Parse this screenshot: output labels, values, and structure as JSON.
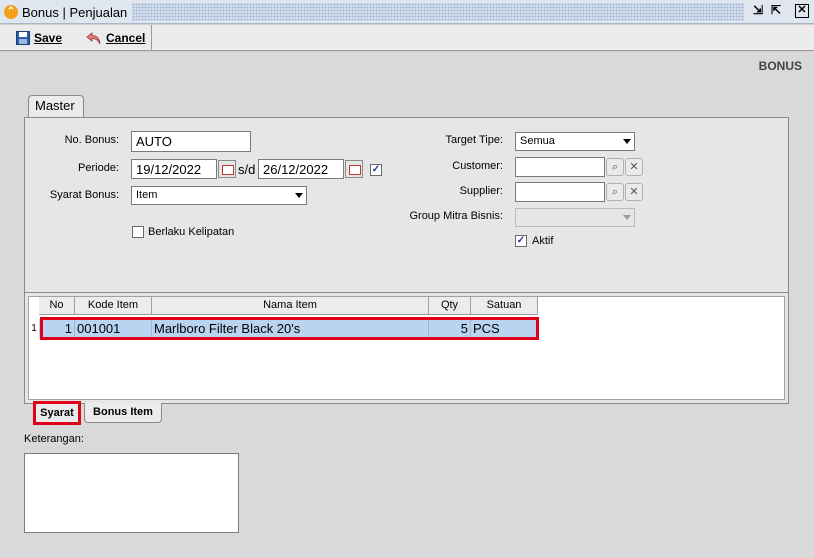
{
  "window": {
    "title": "Bonus | Penjualan",
    "restore_glyph": "⇲",
    "max_glyph": "⇱",
    "close_glyph": "✕"
  },
  "toolbar": {
    "save_label": "Save",
    "cancel_label": "Cancel"
  },
  "header": {
    "label": "BONUS"
  },
  "tabs": {
    "master": "Master"
  },
  "form": {
    "no_bonus_label": "No. Bonus:",
    "no_bonus_value": "AUTO",
    "periode_label": "Periode:",
    "periode_start": "19/12/2022",
    "periode_sep": "s/d",
    "periode_end": "26/12/2022",
    "periode_checked": true,
    "syarat_bonus_label": "Syarat Bonus:",
    "syarat_bonus_value": "Item",
    "berlaku_kelipatan_label": "Berlaku Kelipatan",
    "berlaku_kelipatan_checked": false,
    "target_tipe_label": "Target Tipe:",
    "target_tipe_value": "Semua",
    "customer_label": "Customer:",
    "customer_value": "",
    "supplier_label": "Supplier:",
    "supplier_value": "",
    "group_mitra_label": "Group Mitra Bisnis:",
    "group_mitra_value": "",
    "aktif_label": "Aktif",
    "aktif_checked": true
  },
  "grid": {
    "columns": [
      "No",
      "Kode Item",
      "Nama Item",
      "Qty",
      "Satuan"
    ],
    "rows": [
      {
        "indicator": "1",
        "no": "1",
        "kode": "001001",
        "nama": "Marlboro Filter Black 20's",
        "qty": "5",
        "satuan": "PCS"
      }
    ]
  },
  "bottom_tabs": {
    "syarat": "Syarat",
    "bonus_item": "Bonus Item"
  },
  "keterangan": {
    "label": "Keterangan:",
    "value": ""
  },
  "colors": {
    "highlight_border": "#e0001a",
    "selected_row": "#b8d4f0"
  },
  "icons": {
    "title": "bonus-app-icon",
    "save": "floppy-disk-icon",
    "cancel": "undo-arrow-icon",
    "calendar": "calendar-icon",
    "search": "magnifier-icon",
    "clear": "clear-x-icon"
  }
}
